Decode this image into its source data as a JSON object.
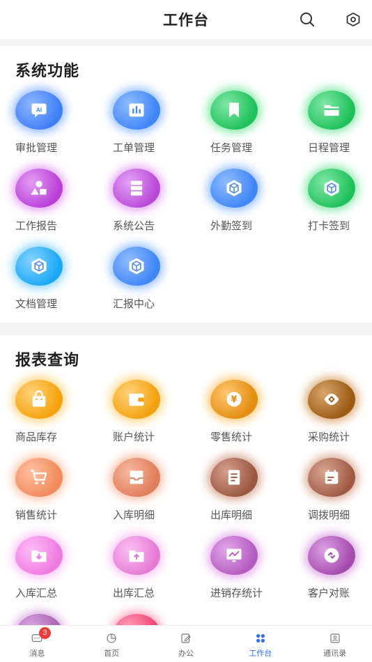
{
  "header": {
    "title": "工作台"
  },
  "sections": [
    {
      "title": "系统功能",
      "items": [
        {
          "label": "审批管理",
          "icon": "ai-chip-icon",
          "color": "#3f7ff6",
          "glow": "#8eb6ff"
        },
        {
          "label": "工单管理",
          "icon": "bar-chart-icon",
          "color": "#3f86f6",
          "glow": "#8fbcff"
        },
        {
          "label": "任务管理",
          "icon": "bookmark-icon",
          "color": "#1fc15b",
          "glow": "#7fe7a4"
        },
        {
          "label": "日程管理",
          "icon": "folder-icon",
          "color": "#1fc15b",
          "glow": "#7fe7a4"
        },
        {
          "label": "工作报告",
          "icon": "shapes-icon",
          "color": "#b93fd8",
          "glow": "#e49cf5"
        },
        {
          "label": "系统公告",
          "icon": "server-list-icon",
          "color": "#b94ad8",
          "glow": "#e4a2f5"
        },
        {
          "label": "外勤签到",
          "icon": "cube-icon",
          "color": "#3f86f6",
          "glow": "#8fbcff"
        },
        {
          "label": "打卡签到",
          "icon": "cube-icon",
          "color": "#1fc15b",
          "glow": "#7fe7a4"
        },
        {
          "label": "文档管理",
          "icon": "cube-icon",
          "color": "#1aa8f5",
          "glow": "#86d3ff"
        },
        {
          "label": "汇报中心",
          "icon": "cube-icon",
          "color": "#3f86f6",
          "glow": "#8fbcff"
        }
      ]
    },
    {
      "title": "报表查询",
      "items": [
        {
          "label": "商品库存",
          "icon": "shopping-bag-icon",
          "color": "#f5a20c",
          "glow": "#ffd27a"
        },
        {
          "label": "账户统计",
          "icon": "wallet-icon",
          "color": "#f2a10e",
          "glow": "#ffd27a"
        },
        {
          "label": "零售统计",
          "icon": "yen-coin-icon",
          "color": "#e38c0e",
          "glow": "#ffc872"
        },
        {
          "label": "采购统计",
          "icon": "eye-diamond-icon",
          "color": "#9a5a12",
          "glow": "#d9a66c"
        },
        {
          "label": "销售统计",
          "icon": "cart-icon",
          "color": "#f08a5a",
          "glow": "#ffc1a2"
        },
        {
          "label": "入库明细",
          "icon": "inbox-icon",
          "color": "#e07d5a",
          "glow": "#f7b9a0"
        },
        {
          "label": "出库明细",
          "icon": "document-icon",
          "color": "#9a5740",
          "glow": "#d5a08d"
        },
        {
          "label": "调拨明细",
          "icon": "calendar-icon",
          "color": "#a05a44",
          "glow": "#d8a692"
        },
        {
          "label": "入库汇总",
          "icon": "folder-download-icon",
          "color": "#ee7ae0",
          "glow": "#ffbdf6"
        },
        {
          "label": "出库汇总",
          "icon": "folder-upload-icon",
          "color": "#e57ad5",
          "glow": "#fcbff1"
        },
        {
          "label": "进销存统计",
          "icon": "monitor-chart-icon",
          "color": "#b45bc0",
          "glow": "#e2a8ea"
        },
        {
          "label": "客户对账",
          "icon": "link-icon",
          "color": "#a54aae",
          "glow": "#dba1e2"
        },
        {
          "label": "",
          "icon": "partial-icon",
          "color": "#a65fb0",
          "glow": "#d9a8e0"
        },
        {
          "label": "",
          "icon": "partial-icon",
          "color": "#ef3f6e",
          "glow": "#ff9fb8"
        }
      ]
    }
  ],
  "tabbar": {
    "tabs": [
      {
        "label": "消息",
        "icon": "message-icon",
        "badge": "3",
        "active": false
      },
      {
        "label": "首页",
        "icon": "pie-chart-icon",
        "badge": "",
        "active": false
      },
      {
        "label": "办公",
        "icon": "edit-note-icon",
        "badge": "",
        "active": false
      },
      {
        "label": "工作台",
        "icon": "grid-dots-icon",
        "badge": "",
        "active": true
      },
      {
        "label": "通讯录",
        "icon": "contacts-icon",
        "badge": "",
        "active": false
      }
    ]
  }
}
